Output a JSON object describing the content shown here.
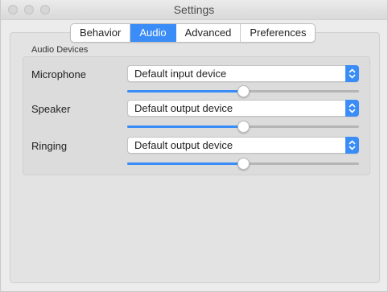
{
  "window": {
    "title": "Settings"
  },
  "tabs": [
    {
      "label": "Behavior",
      "active": false
    },
    {
      "label": "Audio",
      "active": true
    },
    {
      "label": "Advanced",
      "active": false
    },
    {
      "label": "Preferences",
      "active": false
    }
  ],
  "audio_devices": {
    "group_title": "Audio Devices",
    "rows": [
      {
        "label": "Microphone",
        "selected": "Default input device",
        "volume_fraction": 0.5
      },
      {
        "label": "Speaker",
        "selected": "Default output device",
        "volume_fraction": 0.5
      },
      {
        "label": "Ringing",
        "selected": "Default output device",
        "volume_fraction": 0.5
      }
    ]
  },
  "colors": {
    "accent": "#3a8cf7"
  },
  "icons": {
    "dropdown": "chevron-updown-icon"
  }
}
